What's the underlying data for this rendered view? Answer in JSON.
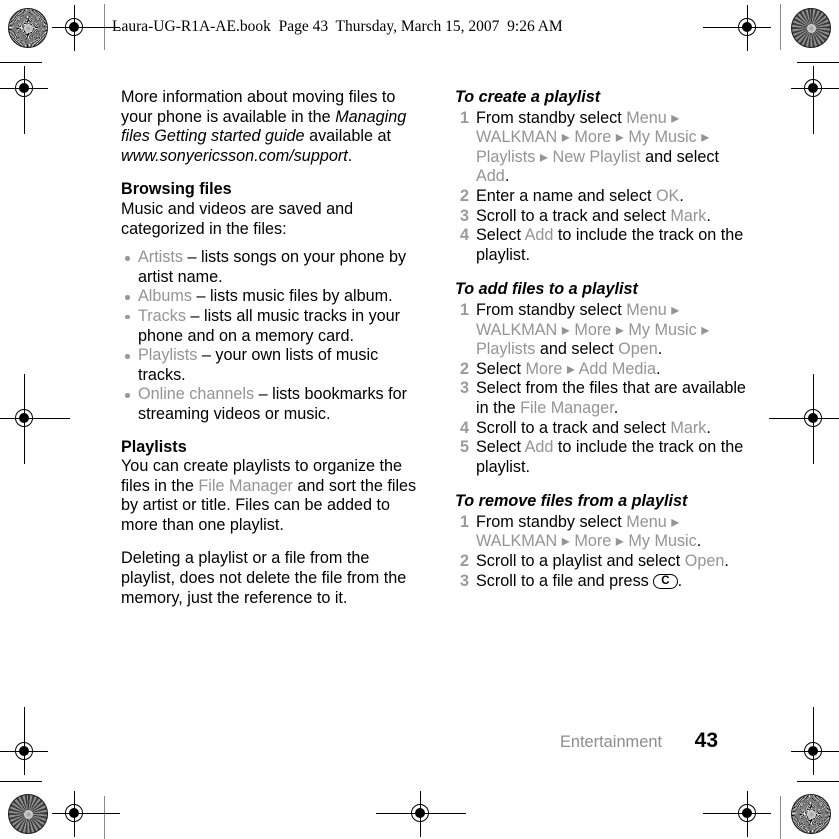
{
  "document": {
    "header_line": "Laura-UG-R1A-AE.book  Page 43  Thursday, March 15, 2007  9:26 AM"
  },
  "left_column": {
    "intro": {
      "t1": "More information about moving files to your phone is available in the ",
      "t2_italic": "Managing files Getting started guide",
      "t3": " available at ",
      "t4_italic": "www.sonyericsson.com/support",
      "t5": "."
    },
    "browsing": {
      "heading": "Browsing files",
      "body": "Music and videos are saved and categorized in the files:",
      "bullets": [
        {
          "term": "Artists",
          "desc": " – lists songs on your phone by artist name."
        },
        {
          "term": "Albums",
          "desc": " – lists music files by album."
        },
        {
          "term": "Tracks",
          "desc": " – lists all music tracks in your phone and on a memory card."
        },
        {
          "term": "Playlists",
          "desc": " – your own lists of music tracks."
        },
        {
          "term": "Online channels",
          "desc": " – lists bookmarks for streaming videos or music."
        }
      ]
    },
    "playlists": {
      "heading": "Playlists",
      "p1_a": "You can create playlists to organize the files in the ",
      "p1_ui": "File Manager",
      "p1_b": " and sort the files by artist or title. Files can be added to more than one playlist.",
      "p2": "Deleting a playlist or a file from the playlist, does not delete the file from the memory, just the reference to it."
    }
  },
  "right_column": {
    "procedures": [
      {
        "title": "To create a playlist",
        "steps": [
          {
            "num": "1",
            "parts": [
              {
                "text": "From standby select ",
                "style": "plain"
              },
              {
                "text": "Menu",
                "style": "ui"
              },
              {
                "text": " ▸ ",
                "style": "ui"
              },
              {
                "text": "WALKMAN",
                "style": "ui"
              },
              {
                "text": " ▸ ",
                "style": "ui"
              },
              {
                "text": "More",
                "style": "ui"
              },
              {
                "text": " ▸ ",
                "style": "ui"
              },
              {
                "text": "My Music",
                "style": "ui"
              },
              {
                "text": " ▸ ",
                "style": "ui"
              },
              {
                "text": "Playlists",
                "style": "ui"
              },
              {
                "text": " ▸ ",
                "style": "ui"
              },
              {
                "text": "New Playlist",
                "style": "ui"
              },
              {
                "text": " and select ",
                "style": "plain"
              },
              {
                "text": "Add",
                "style": "ui"
              },
              {
                "text": ".",
                "style": "plain"
              }
            ]
          },
          {
            "num": "2",
            "parts": [
              {
                "text": "Enter a name and select ",
                "style": "plain"
              },
              {
                "text": "OK",
                "style": "ui"
              },
              {
                "text": ".",
                "style": "plain"
              }
            ]
          },
          {
            "num": "3",
            "parts": [
              {
                "text": "Scroll to a track and select ",
                "style": "plain"
              },
              {
                "text": "Mark",
                "style": "ui"
              },
              {
                "text": ".",
                "style": "plain"
              }
            ]
          },
          {
            "num": "4",
            "parts": [
              {
                "text": "Select ",
                "style": "plain"
              },
              {
                "text": "Add",
                "style": "ui"
              },
              {
                "text": " to include the track on the playlist.",
                "style": "plain"
              }
            ]
          }
        ]
      },
      {
        "title": "To add files to a playlist",
        "steps": [
          {
            "num": "1",
            "parts": [
              {
                "text": "From standby select ",
                "style": "plain"
              },
              {
                "text": "Menu",
                "style": "ui"
              },
              {
                "text": " ▸ ",
                "style": "ui"
              },
              {
                "text": "WALKMAN",
                "style": "ui"
              },
              {
                "text": " ▸ ",
                "style": "ui"
              },
              {
                "text": "More",
                "style": "ui"
              },
              {
                "text": " ▸ ",
                "style": "ui"
              },
              {
                "text": "My Music",
                "style": "ui"
              },
              {
                "text": " ▸ ",
                "style": "ui"
              },
              {
                "text": "Playlists",
                "style": "ui"
              },
              {
                "text": " and select ",
                "style": "plain"
              },
              {
                "text": "Open",
                "style": "ui"
              },
              {
                "text": ".",
                "style": "plain"
              }
            ]
          },
          {
            "num": "2",
            "parts": [
              {
                "text": "Select ",
                "style": "plain"
              },
              {
                "text": "More",
                "style": "ui"
              },
              {
                "text": " ▸ ",
                "style": "ui"
              },
              {
                "text": "Add Media",
                "style": "ui"
              },
              {
                "text": ".",
                "style": "plain"
              }
            ]
          },
          {
            "num": "3",
            "parts": [
              {
                "text": "Select from the files that are available in the ",
                "style": "plain"
              },
              {
                "text": "File Manager",
                "style": "ui"
              },
              {
                "text": ".",
                "style": "plain"
              }
            ]
          },
          {
            "num": "4",
            "parts": [
              {
                "text": "Scroll to a track and select ",
                "style": "plain"
              },
              {
                "text": "Mark",
                "style": "ui"
              },
              {
                "text": ".",
                "style": "plain"
              }
            ]
          },
          {
            "num": "5",
            "parts": [
              {
                "text": "Select ",
                "style": "plain"
              },
              {
                "text": "Add",
                "style": "ui"
              },
              {
                "text": " to include the track on the playlist.",
                "style": "plain"
              }
            ]
          }
        ]
      },
      {
        "title": "To remove files from a playlist",
        "steps": [
          {
            "num": "1",
            "parts": [
              {
                "text": "From standby select ",
                "style": "plain"
              },
              {
                "text": "Menu",
                "style": "ui"
              },
              {
                "text": " ▸ ",
                "style": "ui"
              },
              {
                "text": "WALKMAN",
                "style": "ui"
              },
              {
                "text": " ▸ ",
                "style": "ui"
              },
              {
                "text": "More",
                "style": "ui"
              },
              {
                "text": " ▸ ",
                "style": "ui"
              },
              {
                "text": "My Music",
                "style": "ui"
              },
              {
                "text": ".",
                "style": "plain"
              }
            ]
          },
          {
            "num": "2",
            "parts": [
              {
                "text": "Scroll to a playlist and select ",
                "style": "plain"
              },
              {
                "text": "Open",
                "style": "ui"
              },
              {
                "text": ".",
                "style": "plain"
              }
            ]
          },
          {
            "num": "3",
            "parts": [
              {
                "text": "Scroll to a file and press ",
                "style": "plain"
              },
              {
                "text": "C",
                "style": "keycap"
              },
              {
                "text": ".",
                "style": "plain"
              }
            ]
          }
        ]
      }
    ]
  },
  "footer": {
    "chapter": "Entertainment",
    "page_number": "43"
  },
  "colors": {
    "ui_term_grey": "#949494",
    "bullet_grey": "#9a9a9a",
    "step_number_grey": "#9a9a9a",
    "footer_chapter_grey": "#8d8d8d",
    "text_black": "#000000",
    "page_background": "#ffffff"
  }
}
